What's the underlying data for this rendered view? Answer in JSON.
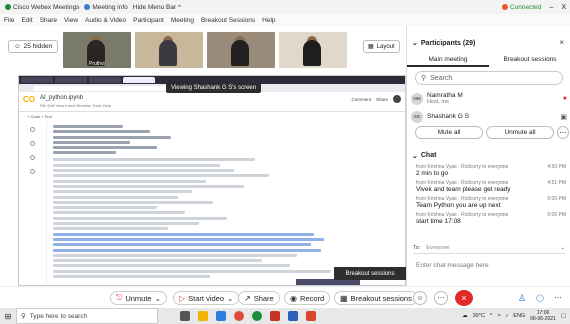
{
  "titlebar": {
    "app_name": "Cisco Webex Meetings",
    "meeting_info": "Meeting info",
    "hide_menu": "Hide Menu Bar ^",
    "status": "Connected",
    "minimize": "–",
    "close": "X"
  },
  "menu": [
    "File",
    "Edit",
    "Share",
    "View",
    "Audio & Video",
    "Participant",
    "Meeting",
    "Breakout Sessions",
    "Help"
  ],
  "main": {
    "hidden_count": "25 hidden",
    "layout_label": "Layout",
    "thumb_label": "Pruthvi",
    "share_caption": "Viewing Shashank G S's screen",
    "breakout_label": "Breakout sessions"
  },
  "notebook": {
    "logo": "CO",
    "title": "AI_python.ipynb",
    "menu_line": "File  Edit  View  Insert  Runtime  Tools  Help",
    "tools": "+ Code  + Text",
    "comment": "Comment",
    "share": "Share"
  },
  "controls": {
    "unmute": "Unmute",
    "start_video": "Start video",
    "share": "Share",
    "record": "Record",
    "breakout": "Breakout sessions"
  },
  "taskbar": {
    "search_placeholder": "Type here to search",
    "weather": "30°C",
    "lang": "ENG",
    "time": "17:06",
    "date": "06-06-2021"
  },
  "participants": {
    "header": "Participants (29)",
    "tabs": [
      "Main meeting",
      "Breakout sessions"
    ],
    "search_placeholder": "Search",
    "list": [
      {
        "initials": "NM",
        "name": "Namratha M",
        "role": "Host, me"
      },
      {
        "initials": "SG",
        "name": "Shashank G S",
        "role": ""
      }
    ],
    "mute_all": "Mute all",
    "unmute_all": "Unmute all"
  },
  "chat": {
    "header": "Chat",
    "messages": [
      {
        "meta": "from Krishna Vyas · Rollcorry to everyone",
        "time": "4:50 PM",
        "text": "2 min to go"
      },
      {
        "meta": "from Krishna Vyas · Rollcorry to everyone",
        "time": "4:51 PM",
        "text": "Vivek and team please get ready"
      },
      {
        "meta": "from Krishna Vyas · Rollcorry to everyone",
        "time": "5:00 PM",
        "text": "Team Python you are up next"
      },
      {
        "meta": "from Krishna Vyas · Rollcorry to everyone",
        "time": "5:06 PM",
        "text": "start time 17:08"
      }
    ],
    "to_label": "To:",
    "to_value": "Everyone",
    "input_placeholder": "Enter chat message here"
  }
}
